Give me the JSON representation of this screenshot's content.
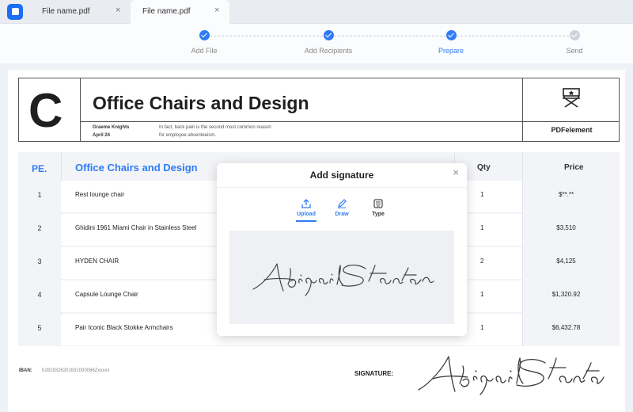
{
  "tabs": [
    {
      "label": "File name.pdf"
    },
    {
      "label": "File name.pdf"
    }
  ],
  "tab_close_glyph": "×",
  "stepper": {
    "steps": [
      {
        "label": "Add File",
        "state": "done"
      },
      {
        "label": "Add Recipients",
        "state": "done"
      },
      {
        "label": "Prepare",
        "state": "active"
      },
      {
        "label": "Send",
        "state": "pending"
      }
    ]
  },
  "document": {
    "logo_letter": "C",
    "title": "Office Chairs and Design",
    "author": "Graeme Knights",
    "date": "April 24",
    "description_line1": "In fact, back pain is the second most common reason",
    "description_line2": "for employee absenteeism.",
    "brand": "PDFelement",
    "brand_icon": "director-chair-icon",
    "table": {
      "headers": {
        "no": "PE.",
        "item": "Office Chairs and Design",
        "qty": "Qty",
        "price": "Price"
      },
      "rows": [
        {
          "no": "1",
          "name": "Rest lounge chair",
          "qty": "1",
          "price": "$**.**"
        },
        {
          "no": "2",
          "name": "Ghidini 1961 Miami Chair in Stainless Steel",
          "qty": "1",
          "price": "$3,510"
        },
        {
          "no": "3",
          "name": "HYDEN CHAIR",
          "qty": "2",
          "price": "$4,125"
        },
        {
          "no": "4",
          "name": "Capsule Lounge Chair",
          "qty": "1",
          "price": "$1,320.92"
        },
        {
          "no": "5",
          "name": "Pair Iconic Black Stokke Armchairs",
          "qty": "1",
          "price": "$6,432.78"
        }
      ]
    },
    "iban_label": "IBAN:",
    "iban_value": "h2819326201631000066Zxxxxx",
    "signature_label": "SIGNATURE:"
  },
  "modal": {
    "title": "Add signature",
    "close_glyph": "×",
    "tabs": [
      {
        "label": "Upload",
        "icon": "upload-icon",
        "active": true
      },
      {
        "label": "Draw",
        "icon": "draw-icon",
        "active": false
      },
      {
        "label": "Type",
        "icon": "keyboard-icon",
        "active": false
      }
    ],
    "signature_name": "Abigail Stanton"
  },
  "colors": {
    "accent": "#2f7cf6",
    "border": "#555555",
    "table_bg": "#f2f4f7"
  }
}
